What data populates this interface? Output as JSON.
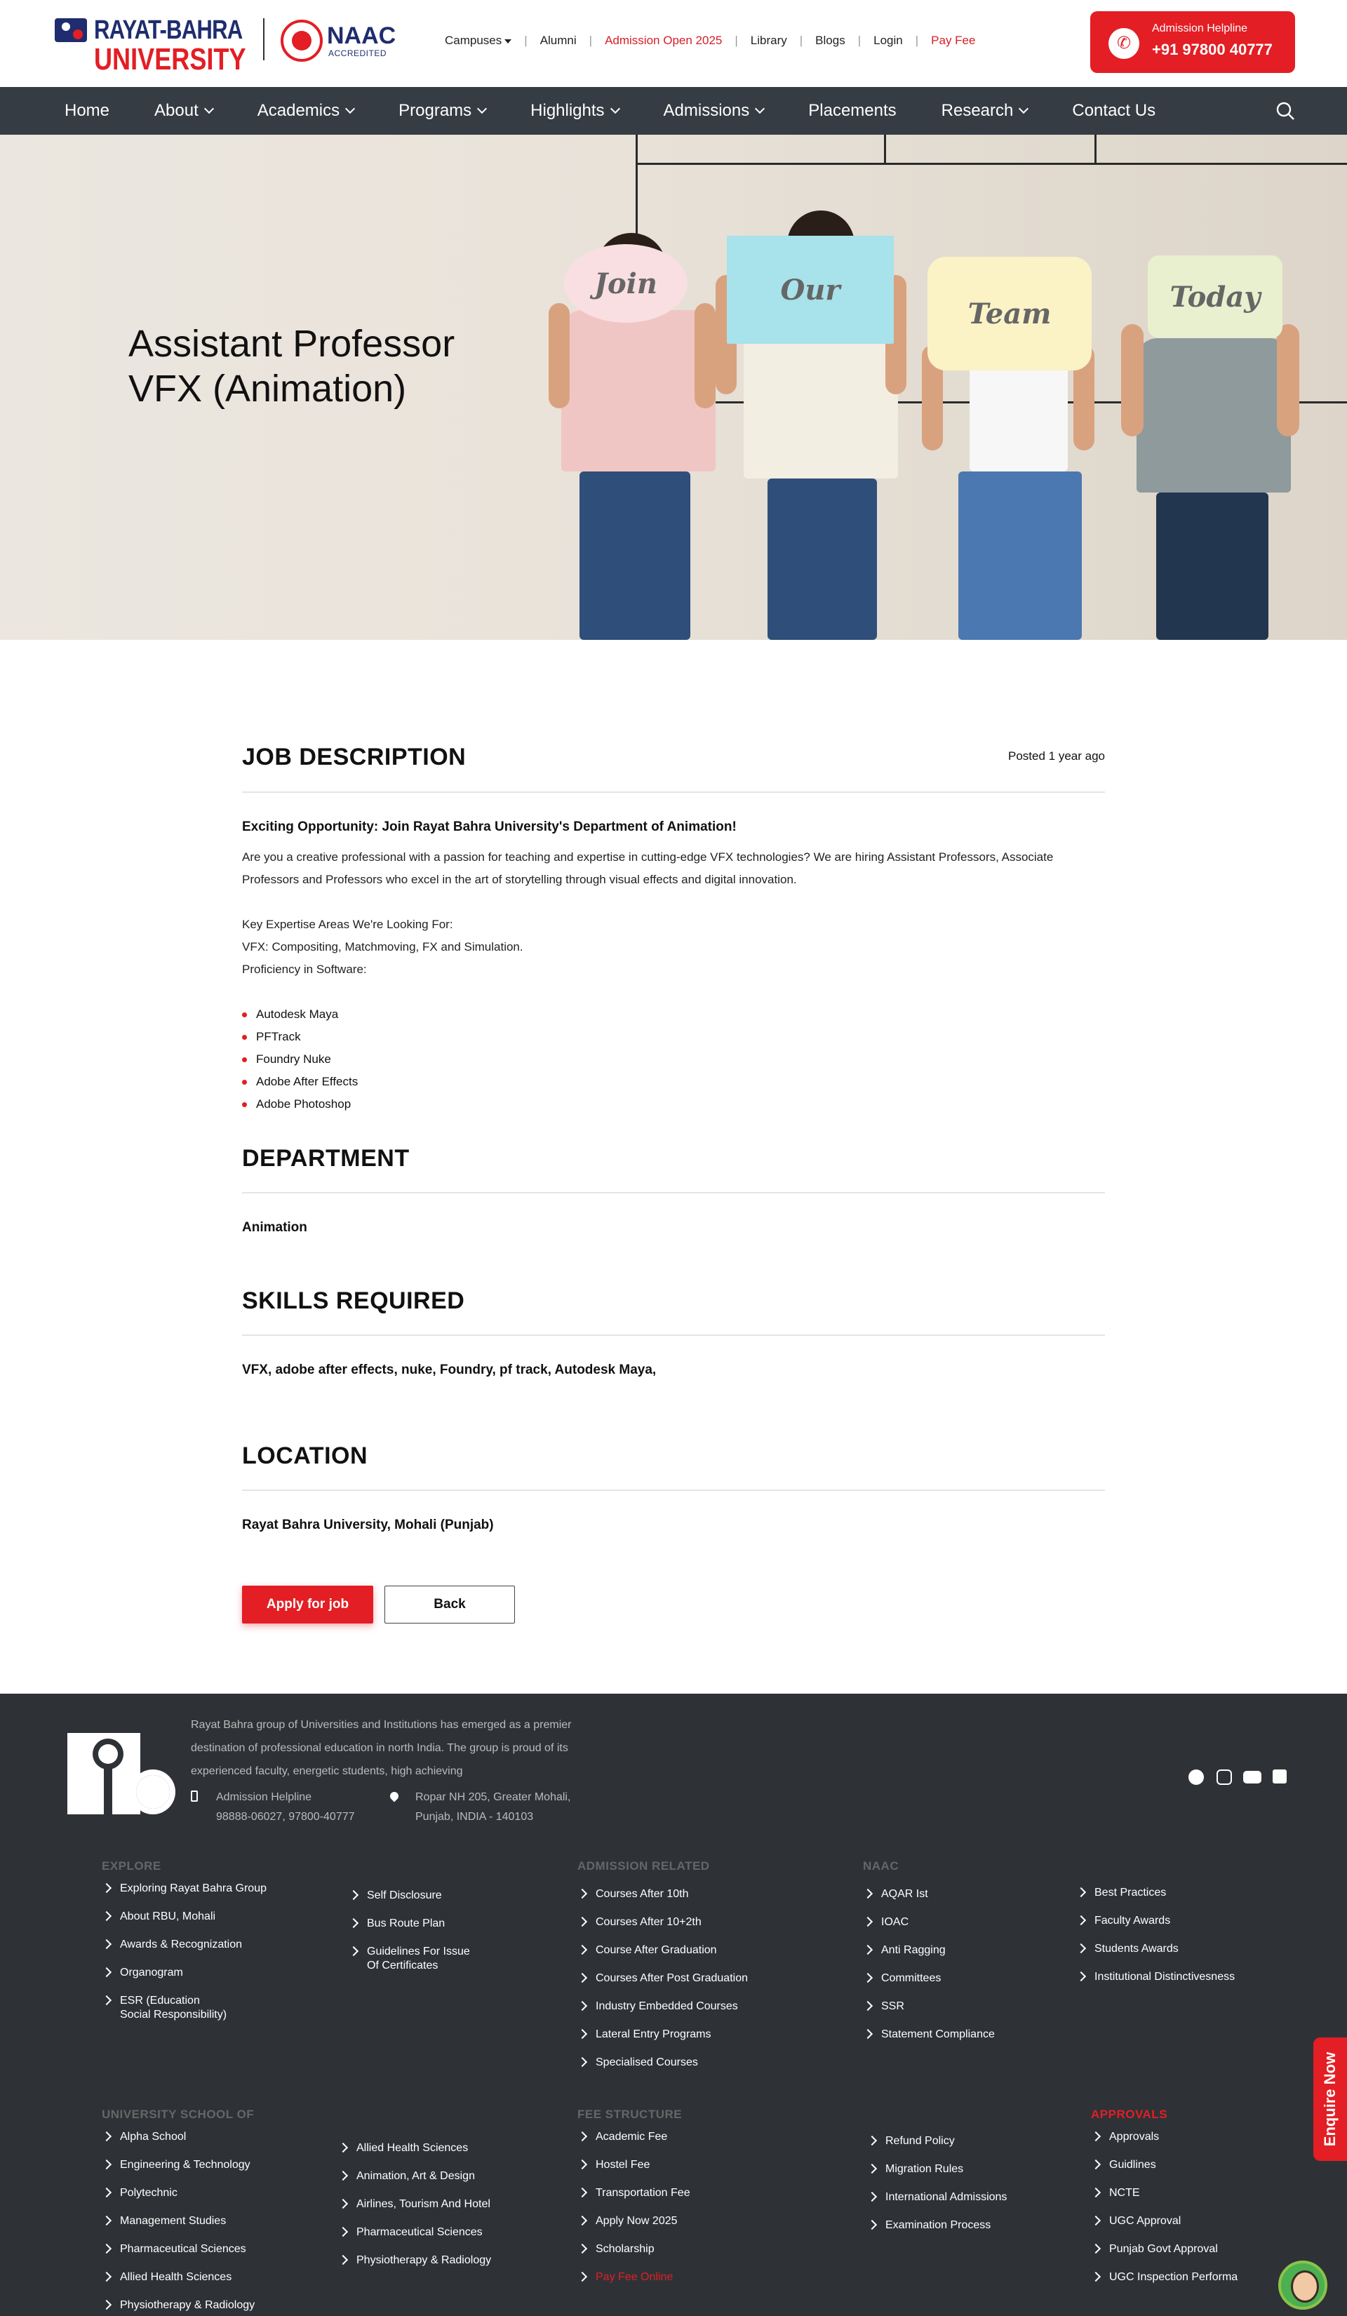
{
  "header": {
    "logo_line1": "RAYAT-BAHRA",
    "logo_line2": "UNIVERSITY",
    "naac_title": "NAAC",
    "naac_sub": "ACCREDITED",
    "links": [
      {
        "label": "Campuses",
        "dropdown": true
      },
      {
        "label": "Alumni"
      },
      {
        "label": "Admission Open 2025",
        "highlight": true
      },
      {
        "label": "Library"
      },
      {
        "label": "Blogs"
      },
      {
        "label": "Login"
      },
      {
        "label": "Pay Fee",
        "highlight": true
      }
    ],
    "helpline_label": "Admission Helpline",
    "helpline_number": "+91 97800 40777",
    "helpline_icon": "phone-icon"
  },
  "nav": {
    "items": [
      {
        "label": "Home",
        "dropdown": false
      },
      {
        "label": "About",
        "dropdown": true
      },
      {
        "label": "Academics",
        "dropdown": true
      },
      {
        "label": "Programs",
        "dropdown": true
      },
      {
        "label": "Highlights",
        "dropdown": true
      },
      {
        "label": "Admissions",
        "dropdown": true
      },
      {
        "label": "Placements",
        "dropdown": false
      },
      {
        "label": "Research",
        "dropdown": true
      },
      {
        "label": "Contact Us",
        "dropdown": false
      }
    ],
    "search_icon": "search-icon"
  },
  "hero": {
    "title_line1": "Assistant Professor",
    "title_line2": "VFX (Animation)",
    "signs": [
      "Join",
      "Our",
      "Team",
      "Today"
    ]
  },
  "job": {
    "heading": "JOB DESCRIPTION",
    "posted": "Posted 1 year ago",
    "intro_title": "Exciting Opportunity: Join Rayat Bahra University's Department of Animation!",
    "intro_text": "Are you a creative professional with a passion for teaching and expertise in cutting-edge VFX technologies? We are hiring Assistant Professors, Associate Professors and Professors who excel in the art of storytelling through visual effects and digital innovation.",
    "expertise_heading": "Key Expertise Areas We're Looking For:",
    "expertise_vfx": "VFX: Compositing, Matchmoving, FX and Simulation.",
    "software_heading": "Proficiency in Software:",
    "software": [
      " Autodesk Maya",
      "PFTrack",
      "Foundry Nuke",
      "Adobe After Effects",
      "Adobe Photoshop"
    ]
  },
  "department": {
    "heading": "DEPARTMENT",
    "value": "Animation"
  },
  "skills": {
    "heading": "SKILLS REQUIRED",
    "value": "VFX, adobe after effects, nuke, Foundry, pf track, Autodesk Maya,"
  },
  "location": {
    "heading": "LOCATION",
    "value": "Rayat Bahra University, Mohali (Punjab)"
  },
  "actions": {
    "apply": "Apply for job",
    "back": "Back"
  },
  "footer": {
    "about": "Rayat Bahra group of Universities and Institutions has emerged as a premier destination of professional education in north India. The group is proud of its experienced faculty, energetic students, high achieving",
    "helpline_label": "Admission Helpline",
    "helpline_numbers": "98888-06027, 97800-40777",
    "address_line1": "Ropar NH 205, Greater Mohali,",
    "address_line2": "Punjab, INDIA - 140103",
    "social": [
      "facebook-icon",
      "instagram-icon",
      "youtube-icon",
      "linkedin-icon"
    ],
    "explore_heading": "EXPLORE",
    "explore": [
      "Exploring Rayat Bahra Group",
      "About RBU, Mohali",
      "Awards & Recognization",
      "Organogram",
      "ESR (Education",
      "Social Responsibility)"
    ],
    "explore2": [
      "Self Disclosure",
      "Bus Route Plan",
      "Guidelines For Issue",
      "Of Certificates"
    ],
    "admission_heading": "ADMISSION RELATED",
    "admission": [
      "Courses After 10th",
      "Courses After 10+2th",
      "Course After Graduation",
      "Courses After Post Graduation",
      "Industry Embedded Courses",
      "Lateral Entry Programs",
      "Specialised Courses"
    ],
    "naac_heading": "NAAC",
    "naac": [
      "AQAR Ist",
      "IOAC",
      "Anti Ragging",
      "Committees",
      "SSR",
      "Statement Compliance"
    ],
    "naac2": [
      "Best Practices",
      "Faculty Awards",
      "Students Awards",
      "Institutional Distinctivesness"
    ],
    "school_heading": "UNIVERSITY SCHOOL OF",
    "school": [
      "Alpha School",
      "Engineering & Technology",
      "Polytechnic",
      "Management Studies",
      "Pharmaceutical Sciences",
      "Allied Health Sciences",
      "Physiotherapy & Radiology"
    ],
    "school2": [
      "Allied Health Sciences",
      "Animation, Art & Design",
      "Airlines, Tourism And Hotel",
      "Pharmaceutical Sciences",
      "Physiotherapy & Radiology"
    ],
    "fee_heading": "FEE STRUCTURE",
    "fee": [
      "Academic Fee",
      "Hostel Fee",
      "Transportation Fee",
      "Apply Now 2025",
      "Scholarship",
      "Pay Fee Online"
    ],
    "fee2": [
      "Refund Policy",
      "Migration Rules",
      "International Admissions",
      "Examination Process"
    ],
    "approvals_heading": "APPROVALS",
    "approvals": [
      "Approvals",
      "Guidlines",
      "NCTE",
      "UGC Approval",
      "Punjab Govt Approval",
      "UGC Inspection Performa"
    ]
  },
  "enquire": "Enquire Now",
  "colors": {
    "brand_red": "#e31e24",
    "brand_blue": "#1f2d6e",
    "nav_bg": "#353c44",
    "footer_bg": "#2e3237"
  }
}
